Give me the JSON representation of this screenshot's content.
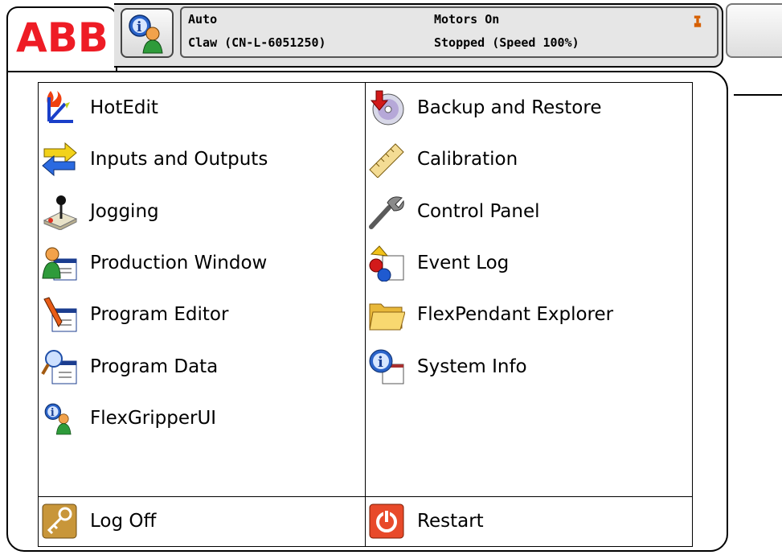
{
  "brand": {
    "logo_text": "ABB",
    "color": "#ee1c25"
  },
  "status": {
    "mode": "Auto",
    "system_name": "Claw (CN-L-6051250)",
    "motors": "Motors On",
    "state": "Stopped (Speed 100%)"
  },
  "menu": {
    "left": [
      {
        "label": "HotEdit",
        "icon": "hotedit-icon"
      },
      {
        "label": "Inputs and Outputs",
        "icon": "io-arrows-icon"
      },
      {
        "label": "Jogging",
        "icon": "joystick-icon"
      },
      {
        "label": "Production Window",
        "icon": "production-window-icon"
      },
      {
        "label": "Program Editor",
        "icon": "program-editor-icon"
      },
      {
        "label": "Program Data",
        "icon": "program-data-icon"
      },
      {
        "label": "FlexGripperUI",
        "icon": "info-person-icon"
      }
    ],
    "right": [
      {
        "label": "Backup and Restore",
        "icon": "backup-disc-icon"
      },
      {
        "label": "Calibration",
        "icon": "ruler-icon"
      },
      {
        "label": "Control Panel",
        "icon": "wrench-icon"
      },
      {
        "label": "Event Log",
        "icon": "event-log-icon"
      },
      {
        "label": "FlexPendant Explorer",
        "icon": "folder-icon"
      },
      {
        "label": "System Info",
        "icon": "system-info-icon"
      }
    ],
    "bottom_left": {
      "label": "Log Off",
      "icon": "key-icon"
    },
    "bottom_right": {
      "label": "Restart",
      "icon": "power-icon"
    }
  }
}
